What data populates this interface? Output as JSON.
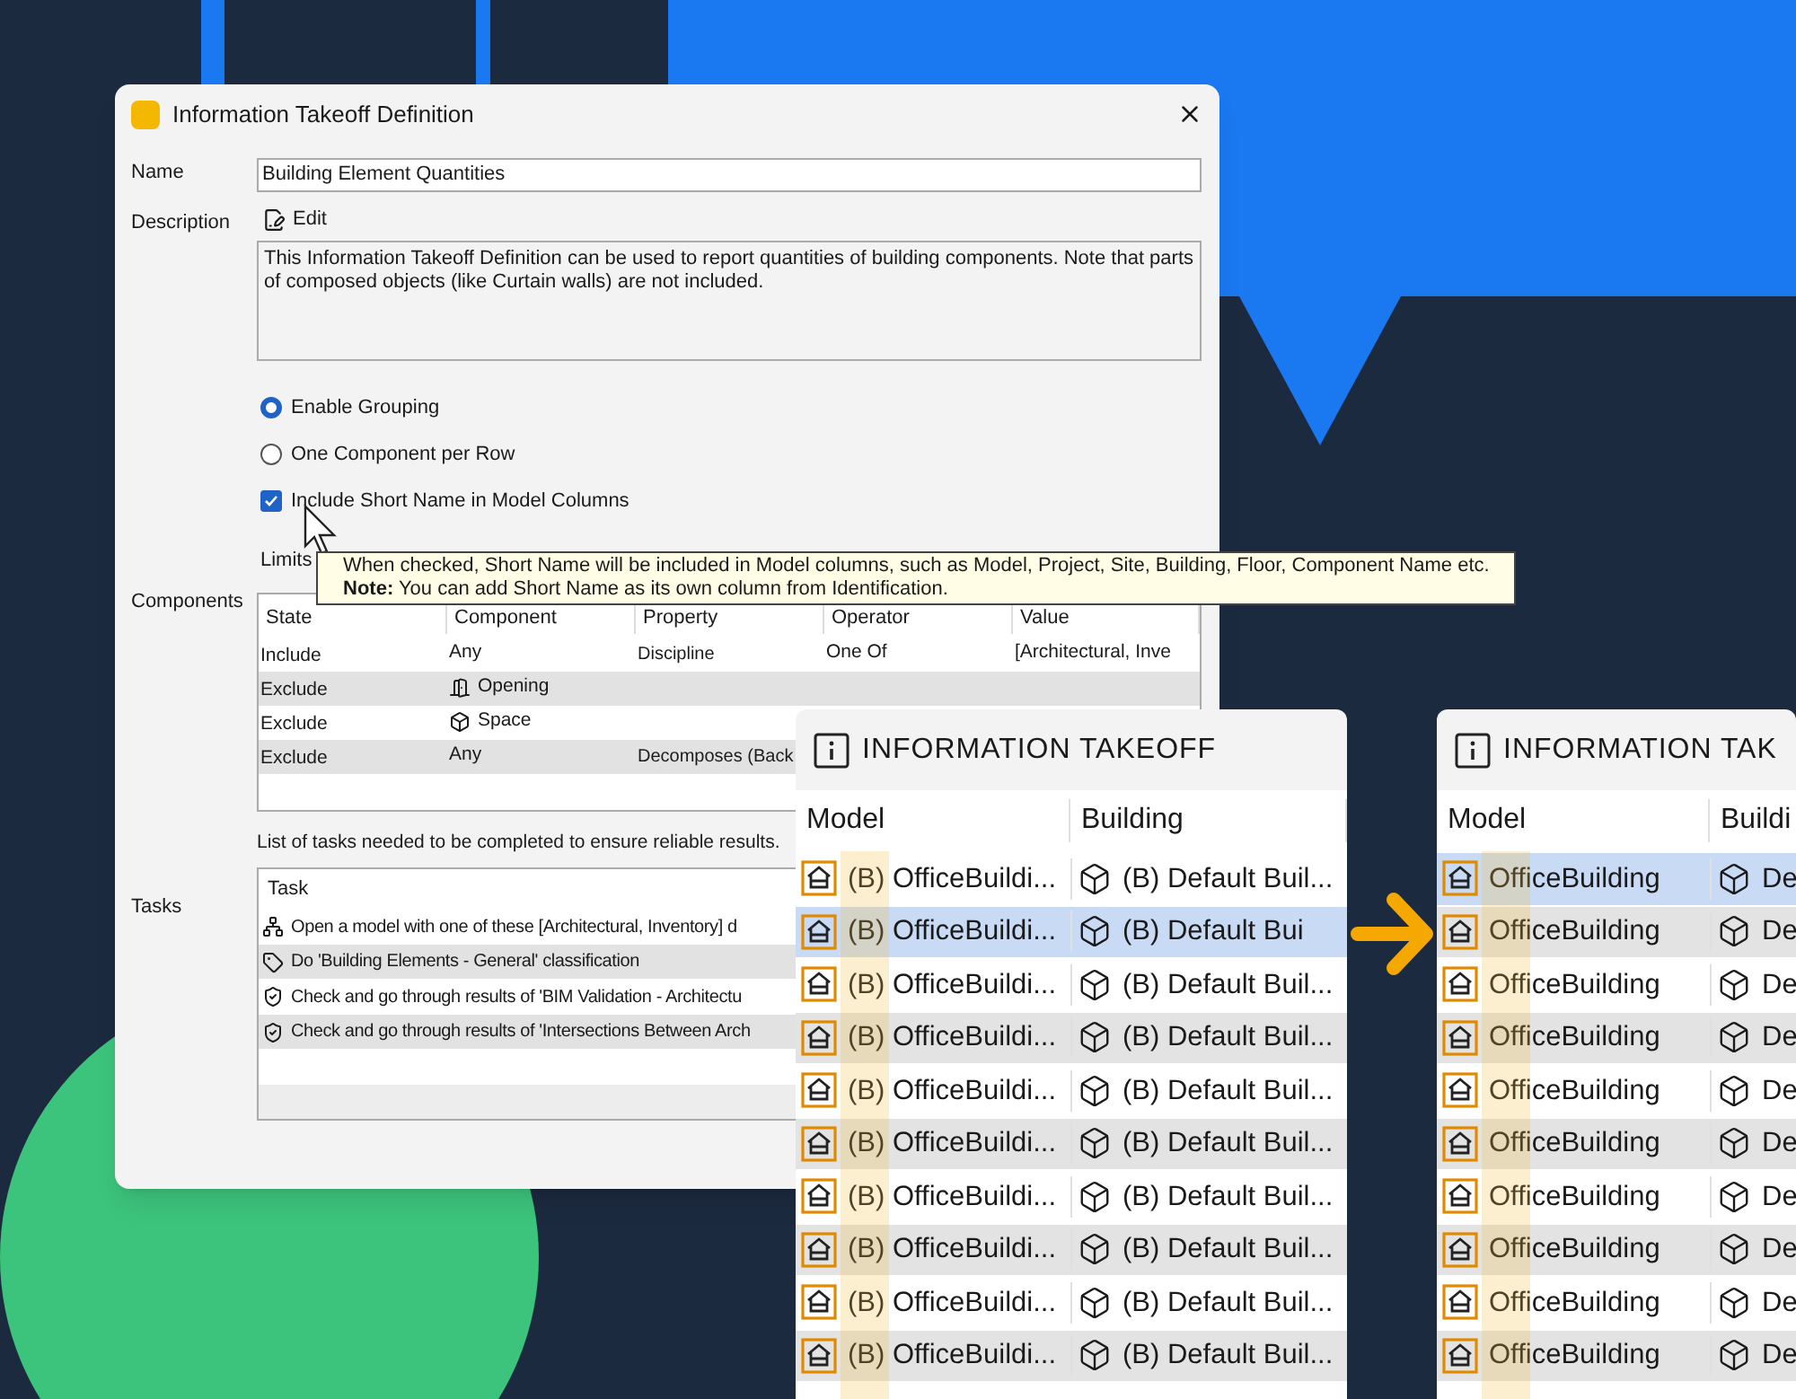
{
  "dialog": {
    "title": "Information Takeoff Definition",
    "name_label": "Name",
    "name_value": "Building Element Quantities",
    "description_label": "Description",
    "edit_button": "Edit",
    "description": "This Information Takeoff Definition can be used to report quantities of building components. Note that parts of composed objects (like Curtain walls) are not included.",
    "options": [
      {
        "kind": "radio",
        "label": "Enable Grouping",
        "selected": true
      },
      {
        "kind": "radio",
        "label": "One Component per Row",
        "selected": false
      },
      {
        "kind": "checkbox",
        "label": "Include Short Name in Model Columns",
        "checked": true
      }
    ],
    "limits_label": "Limits",
    "components": {
      "label": "Components",
      "columns": [
        "State",
        "Component",
        "Property",
        "Operator",
        "Value"
      ],
      "rows": [
        {
          "state": "Include",
          "kind": "plain",
          "component": "Any",
          "property": "Discipline",
          "operator": "One Of",
          "value": "[Architectural, Inve"
        },
        {
          "state": "Exclude",
          "kind": "opening",
          "component": "Opening",
          "property": "",
          "operator": "",
          "value": ""
        },
        {
          "state": "Exclude",
          "kind": "space",
          "component": "Space",
          "property": "",
          "operator": "",
          "value": ""
        },
        {
          "state": "Exclude",
          "kind": "plain",
          "component": "Any",
          "property": "Decomposes (Back",
          "operator": "",
          "value": ""
        }
      ]
    },
    "tasks_caption": "List of tasks needed to be completed to ensure reliable results.",
    "tasks": {
      "label": "Tasks",
      "column": "Task",
      "rows": [
        {
          "kind": "model",
          "text": "Open a model with one of these [Architectural, Inventory] d"
        },
        {
          "kind": "classification",
          "text": "Do 'Building Elements - General' classification"
        },
        {
          "kind": "check",
          "text": "Check and go through results of 'BIM Validation - Architectu"
        },
        {
          "kind": "check",
          "text": "Check and go through results of 'Intersections Between Arch"
        }
      ]
    }
  },
  "tooltip": {
    "lines": [
      "When checked, Short Name will be included in Model columns, such as Model, Project, Site, Building, Floor, Component Name etc.",
      "**Note:** You can add Short Name as its own column from Identification."
    ]
  },
  "takeoff_panels": [
    {
      "title": "INFORMATION TAKEOFF",
      "columns": [
        "Model",
        "Building"
      ],
      "rows": [
        {
          "model": "(B) OfficeBuildi...",
          "building": "(B) Default Buil...",
          "selected": false
        },
        {
          "model": "(B) OfficeBuildi...",
          "building": "(B) Default Bui",
          "selected": true
        },
        {
          "model": "(B) OfficeBuildi...",
          "building": "(B) Default Buil...",
          "selected": false
        },
        {
          "model": "(B) OfficeBuildi...",
          "building": "(B) Default Buil...",
          "selected": false
        },
        {
          "model": "(B) OfficeBuildi...",
          "building": "(B) Default Buil...",
          "selected": false
        },
        {
          "model": "(B) OfficeBuildi...",
          "building": "(B) Default Buil...",
          "selected": false
        },
        {
          "model": "(B) OfficeBuildi...",
          "building": "(B) Default Buil...",
          "selected": false
        },
        {
          "model": "(B) OfficeBuildi...",
          "building": "(B) Default Buil...",
          "selected": false
        },
        {
          "model": "(B) OfficeBuildi...",
          "building": "(B) Default Buil...",
          "selected": false
        },
        {
          "model": "(B) OfficeBuildi...",
          "building": "(B) Default Buil...",
          "selected": false
        }
      ]
    },
    {
      "title": "INFORMATION TAK",
      "columns": [
        "Model",
        "Buildi"
      ],
      "rows": [
        {
          "model": "OfficeBuilding",
          "building": "De",
          "selected": true
        },
        {
          "model": "OfficeBuilding",
          "building": "De",
          "selected": false
        },
        {
          "model": "OfficeBuilding",
          "building": "De",
          "selected": false
        },
        {
          "model": "OfficeBuilding",
          "building": "De",
          "selected": false
        },
        {
          "model": "OfficeBuilding",
          "building": "De",
          "selected": false
        },
        {
          "model": "OfficeBuilding",
          "building": "De",
          "selected": false
        },
        {
          "model": "OfficeBuilding",
          "building": "De",
          "selected": false
        },
        {
          "model": "OfficeBuilding",
          "building": "De",
          "selected": false
        },
        {
          "model": "OfficeBuilding",
          "building": "De",
          "selected": false
        },
        {
          "model": "OfficeBuilding",
          "building": "De",
          "selected": false
        }
      ]
    }
  ]
}
